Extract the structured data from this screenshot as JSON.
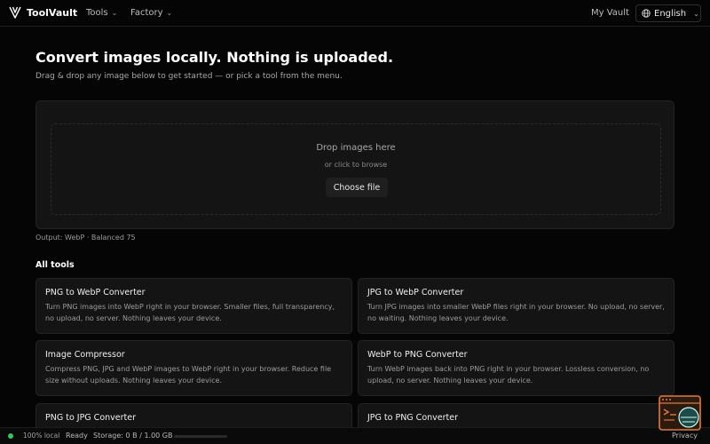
{
  "header": {
    "brand": "ToolVault",
    "nav": {
      "tools": "Tools",
      "factory": "Factory",
      "my_vault": "My Vault"
    },
    "language": "English"
  },
  "hero": {
    "title": "Convert images locally. Nothing is uploaded.",
    "subtitle": "Drag & drop any image below to get started — or pick a tool from the menu."
  },
  "dropzone": {
    "title": "Drop images here",
    "subtitle": "or click to browse",
    "button_label": "Choose file"
  },
  "output_settings": "Output: WebP · Balanced 75",
  "tools_section": {
    "title": "All tools",
    "cards": [
      {
        "title": "PNG to WebP Converter",
        "description": "Turn PNG images into WebP right in your browser. Smaller files, full transparency, no upload, no server. Nothing leaves your device."
      },
      {
        "title": "JPG to WebP Converter",
        "description": "Turn JPG images into smaller WebP files right in your browser. No upload, no server, no waiting. Nothing leaves your device."
      },
      {
        "title": "Image Compressor",
        "description": "Compress PNG, JPG and WebP images to WebP right in your browser. Reduce file size without uploads. Nothing leaves your device."
      },
      {
        "title": "WebP to PNG Converter",
        "description": "Turn WebP images back into PNG right in your browser. Lossless conversion, no upload, no server. Nothing leaves your device."
      },
      {
        "title": "PNG to JPG Converter",
        "description": ""
      },
      {
        "title": "JPG to PNG Converter",
        "description": ""
      }
    ]
  },
  "statusbar": {
    "local_label": "100% local",
    "status": "Ready",
    "storage": "Storage: 0 B / 1.00 GB",
    "storage_fraction": 0.0,
    "privacy": "Privacy"
  },
  "colors": {
    "background": "#050505",
    "card": "#141414",
    "status_dot": "#34c759",
    "widget_accent": "#e07a3c",
    "widget_screen": "#1f4a4a"
  },
  "icons": [
    "logo-icon",
    "chevron-down-icon",
    "globe-icon",
    "terminal-widget-icon"
  ]
}
